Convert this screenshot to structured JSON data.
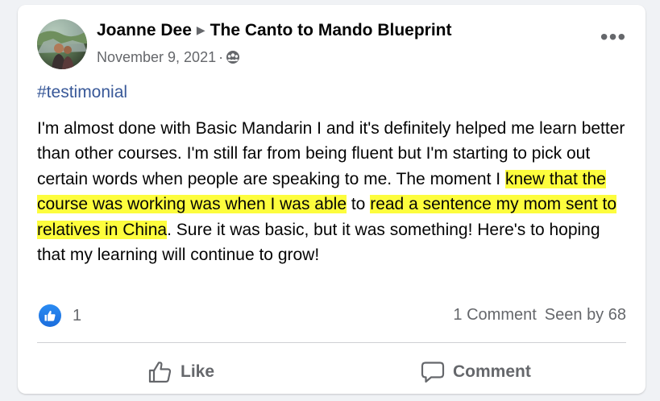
{
  "post": {
    "author": "Joanne Dee",
    "group": "The Canto to Mando Blueprint",
    "date": "November 9, 2021",
    "date_separator": "·",
    "privacy_icon": "members-icon",
    "more_label": "•••",
    "hashtag": "#testimonial",
    "body": {
      "part1": "I'm almost done with Basic Mandarin I and it's definitely helped me learn better than other courses. I'm still far from being fluent but I'm starting to pick out certain words when people are speaking to me. The moment I ",
      "highlight1": "knew that the course was working was when I was able",
      "part2": " to ",
      "highlight2": "read a sentence my mom sent to relatives in China",
      "part3": ". Sure it was basic, but it was something! Here's to hoping that my learning will continue to grow!"
    },
    "highlight_color": "#fdfd3d"
  },
  "footer": {
    "reaction_icon": "thumbs-up-icon",
    "reaction_count": "1",
    "comments": "1 Comment",
    "seen_by": "Seen by 68",
    "like_label": "Like",
    "comment_label": "Comment"
  },
  "colors": {
    "background": "#f0f2f5",
    "card": "#ffffff",
    "secondary_text": "#65676b",
    "hashtag": "#385898",
    "like_blue": "#1b74e4"
  }
}
